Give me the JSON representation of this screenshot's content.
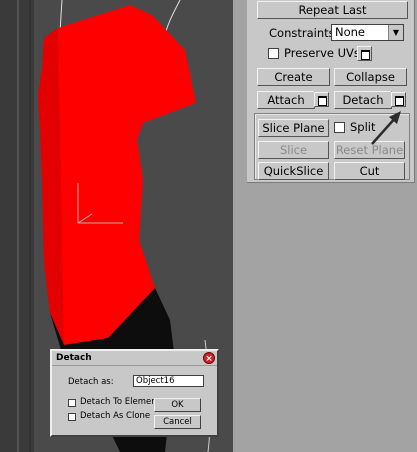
{
  "command_panel": {
    "repeat_last": "Repeat Last",
    "constraints_label": "Constraints:",
    "constraints_value": "None",
    "preserve_uvs_label": "Preserve UVs",
    "create": "Create",
    "collapse": "Collapse",
    "attach": "Attach",
    "detach": "Detach",
    "slice_plane": "Slice Plane",
    "split_label": "Split",
    "slice": "Slice",
    "reset_plane": "Reset Plane",
    "quickslice": "QuickSlice",
    "cut": "Cut"
  },
  "detach_dialog": {
    "title": "Detach",
    "detach_as_label": "Detach as:",
    "detach_as_value": "Object16",
    "detach_to_element": "Detach To Element",
    "detach_as_clone": "Detach As Clone",
    "ok": "OK",
    "cancel": "Cancel"
  },
  "colors": {
    "object_fill": "#ff0000",
    "viewport_bg": "#4a4a4a",
    "panel_bg": "#c8c8c8"
  }
}
